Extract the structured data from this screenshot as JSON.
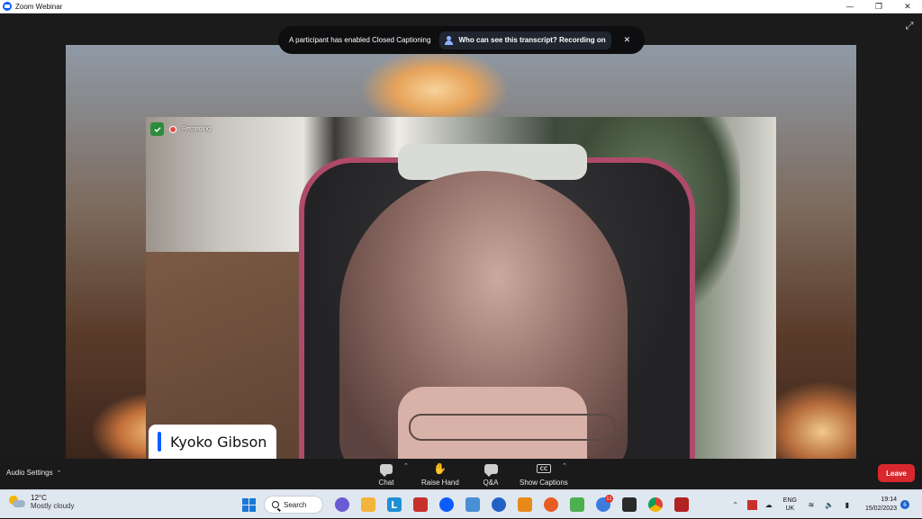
{
  "window": {
    "title": "Zoom Webinar",
    "controls": [
      "minimize",
      "restore",
      "close"
    ]
  },
  "banner": {
    "message": "A participant has enabled Closed Captioning",
    "who_label": "Who can see this transcript? Recording on"
  },
  "video": {
    "recording_label": "Recording",
    "participant_name": "Kyoko Gibson"
  },
  "controls": {
    "audio_settings": "Audio Settings",
    "chat": "Chat",
    "raise_hand": "Raise Hand",
    "qa": "Q&A",
    "show_captions": "Show Captions",
    "cc_icon_text": "CC",
    "leave": "Leave",
    "leave_color": "#d8282d"
  },
  "taskbar": {
    "weather": {
      "temp": "12°C",
      "condition": "Mostly cloudy"
    },
    "search_label": "Search",
    "apps": [
      {
        "name": "windows-start-icon",
        "color": "#1a78d6"
      },
      {
        "name": "teams-chat-icon",
        "color": "#6b5bd2"
      },
      {
        "name": "file-explorer-icon",
        "color": "#f2b43a"
      },
      {
        "name": "l-app-icon",
        "color": "#1e90d6"
      },
      {
        "name": "filezilla-icon",
        "color": "#c8302c"
      },
      {
        "name": "zoom-icon",
        "color": "#0b5cff"
      },
      {
        "name": "notepad-app-icon",
        "color": "#4a8fd4"
      },
      {
        "name": "malwarebytes-icon",
        "color": "#2361c7"
      },
      {
        "name": "media-app-icon",
        "color": "#e88a1a"
      },
      {
        "name": "firefox-icon",
        "color": "#e85d22"
      },
      {
        "name": "notebook-app-icon",
        "color": "#4caf50"
      },
      {
        "name": "social-app-icon",
        "color": "#3d7be0"
      },
      {
        "name": "terminal-icon",
        "color": "#2a2a2a"
      },
      {
        "name": "chrome-icon",
        "color": "#db4437"
      },
      {
        "name": "game-app-icon",
        "color": "#b22222"
      }
    ],
    "social_badge": "11",
    "lang_line1": "ENG",
    "lang_line2": "UK",
    "time": "19:14",
    "date": "15/02/2023",
    "notification_count": "6"
  }
}
